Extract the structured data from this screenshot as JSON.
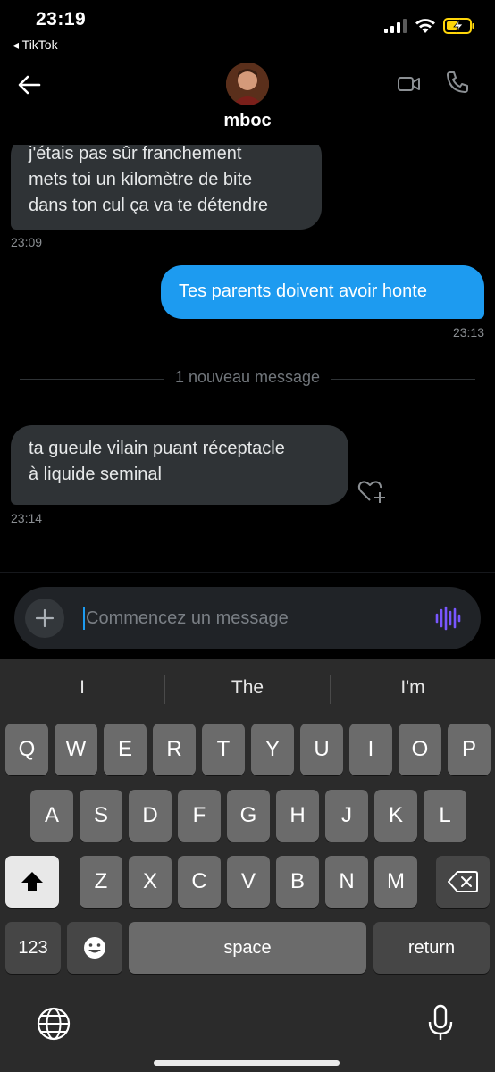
{
  "status_bar": {
    "time": "23:19",
    "back_app": "◂ TikTok"
  },
  "header": {
    "username": "mboc"
  },
  "messages": [
    {
      "direction": "in",
      "text_lines": [
        "j'étais pas sûr franchement",
        "mets toi un kilomètre de bite",
        "dans ton cul ça va te détendre"
      ],
      "time": "23:09"
    },
    {
      "direction": "out",
      "text_lines": [
        "Tes parents doivent avoir honte"
      ],
      "time": "23:13"
    },
    {
      "direction": "in",
      "text_lines": [
        "ta gueule vilain puant réceptacle",
        "à liquide seminal"
      ],
      "time": "23:14"
    }
  ],
  "divider": {
    "label": "1 nouveau message"
  },
  "composer": {
    "placeholder": "Commencez un message",
    "add_icon": "plus-icon",
    "voice_icon": "voice-wave-icon"
  },
  "keyboard": {
    "suggestions": [
      "I",
      "The",
      "I'm"
    ],
    "row1": [
      "Q",
      "W",
      "E",
      "R",
      "T",
      "Y",
      "U",
      "I",
      "O",
      "P"
    ],
    "row2": [
      "A",
      "S",
      "D",
      "F",
      "G",
      "H",
      "J",
      "K",
      "L"
    ],
    "row3": [
      "Z",
      "X",
      "C",
      "V",
      "B",
      "N",
      "M"
    ],
    "numbers_key": "123",
    "space_key": "space",
    "return_key": "return"
  },
  "colors": {
    "accent": "#1d9bf0",
    "incoming_bubble": "#2f3336",
    "background": "#000000",
    "voice": "#7856ff",
    "battery": "#ffd60a"
  }
}
